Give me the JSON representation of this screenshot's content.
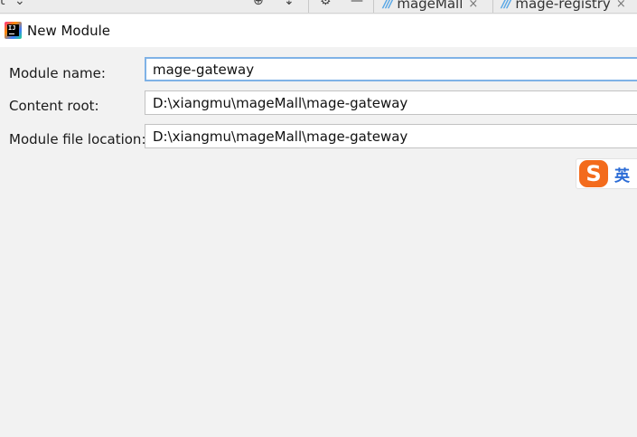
{
  "top_strip": {
    "left_glyph": "t",
    "left_chevron": "⌄",
    "icons": [
      "circle-plus-icon",
      "collapse-icon",
      "gear-icon",
      "minimize-icon"
    ],
    "tabs": [
      {
        "label": "mageMall",
        "close": "×"
      },
      {
        "label": "mage-registry",
        "close": "×"
      }
    ]
  },
  "dialog": {
    "title": "New Module"
  },
  "form": {
    "module_name_label": "Module name:",
    "module_name_value": "mage-gateway",
    "content_root_label": "Content root:",
    "content_root_value": "D:\\xiangmu\\mageMall\\mage-gateway",
    "module_file_location_label": "Module file location:",
    "module_file_location_value": "D:\\xiangmu\\mageMall\\mage-gateway"
  },
  "ime": {
    "logo": "S",
    "mode": "英"
  },
  "colors": {
    "background": "#f2f2f2",
    "focus_border": "#7fb2e6",
    "ime_logo": "#f36b1c",
    "ime_mode": "#2b6cd6"
  }
}
